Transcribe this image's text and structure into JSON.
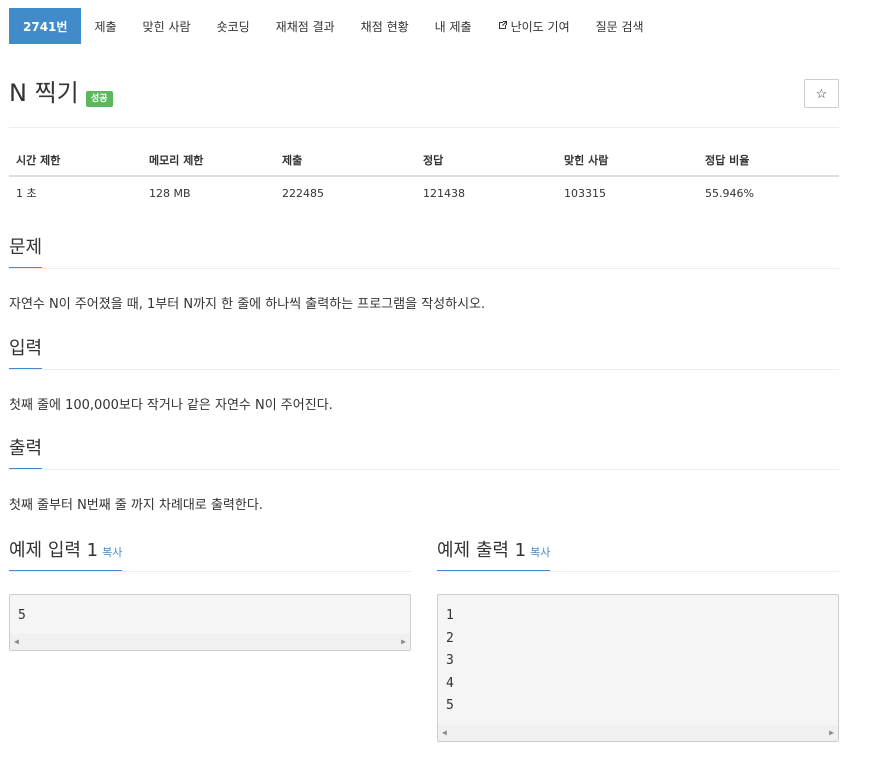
{
  "nav": {
    "items": [
      {
        "label": "2741번",
        "active": true
      },
      {
        "label": "제출"
      },
      {
        "label": "맞힌 사람"
      },
      {
        "label": "숏코딩"
      },
      {
        "label": "재채점 결과"
      },
      {
        "label": "채점 현황"
      },
      {
        "label": "내 제출"
      },
      {
        "label": "난이도 기여",
        "icon": "external-link-icon"
      },
      {
        "label": "질문 검색"
      }
    ]
  },
  "problem": {
    "title": "N 찍기",
    "badge": "성공",
    "star_icon": "☆"
  },
  "info_table": {
    "headers": [
      "시간 제한",
      "메모리 제한",
      "제출",
      "정답",
      "맞힌 사람",
      "정답 비율"
    ],
    "values": [
      "1 초",
      "128 MB",
      "222485",
      "121438",
      "103315",
      "55.946%"
    ]
  },
  "sections": {
    "problem": {
      "title": "문제",
      "body": "자연수 N이 주어졌을 때, 1부터 N까지 한 줄에 하나씩 출력하는 프로그램을 작성하시오."
    },
    "input": {
      "title": "입력",
      "body": "첫째 줄에 100,000보다 작거나 같은 자연수 N이 주어진다."
    },
    "output": {
      "title": "출력",
      "body": "첫째 줄부터 N번째 줄 까지 차례대로 출력한다."
    }
  },
  "samples": {
    "input": {
      "title": "예제 입력 1",
      "copy": "복사",
      "lines": [
        "5"
      ]
    },
    "output": {
      "title": "예제 출력 1",
      "copy": "복사",
      "lines": [
        "1",
        "2",
        "3",
        "4",
        "5"
      ]
    }
  },
  "colors": {
    "accent": "#428bca",
    "success": "#5cb85c"
  }
}
